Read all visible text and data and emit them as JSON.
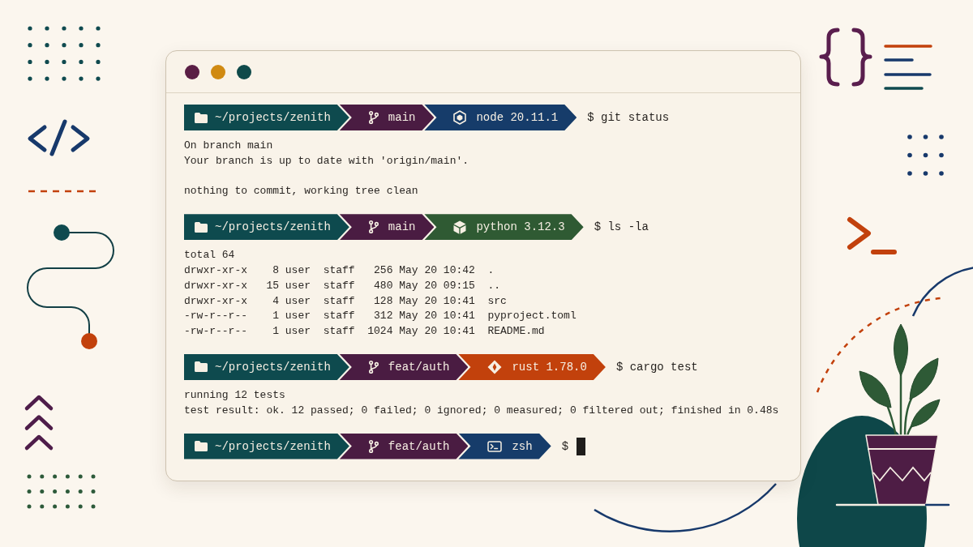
{
  "terminal": {
    "blocks": [
      {
        "segments": [
          {
            "kind": "path",
            "text": "~/projects/zenith",
            "color": "#0e4a4e"
          },
          {
            "kind": "branch",
            "text": "main",
            "color": "#4a1c42"
          },
          {
            "kind": "node",
            "text": "node 20.11.1",
            "color": "#163c6a"
          }
        ],
        "command": "$ git status",
        "cursor": false,
        "output": [
          [
            "On branch main",
            "Your branch is up to date with 'origin/main'."
          ],
          [
            "nothing to commit, working tree clean"
          ]
        ]
      },
      {
        "segments": [
          {
            "kind": "path",
            "text": "~/projects/zenith",
            "color": "#0e4a4e"
          },
          {
            "kind": "branch",
            "text": "main",
            "color": "#4a1c42"
          },
          {
            "kind": "python",
            "text": "python 3.12.3",
            "color": "#2f5a33"
          }
        ],
        "command": "$ ls -la",
        "cursor": false,
        "output": [
          [
            "total 64",
            "drwxr-xr-x    8 user  staff   256 May 20 10:42  .",
            "drwxr-xr-x   15 user  staff   480 May 20 09:15  ..",
            "drwxr-xr-x    4 user  staff   128 May 20 10:41  src",
            "-rw-r--r--    1 user  staff   312 May 20 10:41  pyproject.toml",
            "-rw-r--r--    1 user  staff  1024 May 20 10:41  README.md"
          ]
        ]
      },
      {
        "segments": [
          {
            "kind": "path",
            "text": "~/projects/zenith",
            "color": "#0e4a4e"
          },
          {
            "kind": "branch",
            "text": "feat/auth",
            "color": "#4a1c42"
          },
          {
            "kind": "rust",
            "text": "rust 1.78.0",
            "color": "#c2410c"
          }
        ],
        "command": "$ cargo test",
        "cursor": false,
        "output": [
          [
            "running 12 tests",
            "test result: ok. 12 passed; 0 failed; 0 ignored; 0 measured; 0 filtered out; finished in 0.48s"
          ]
        ]
      },
      {
        "segments": [
          {
            "kind": "path",
            "text": "~/projects/zenith",
            "color": "#0e4a4e"
          },
          {
            "kind": "branch",
            "text": "feat/auth",
            "color": "#4a1c42"
          },
          {
            "kind": "shell",
            "text": "zsh",
            "color": "#163c6a"
          }
        ],
        "command": "$",
        "cursor": true
      }
    ]
  }
}
